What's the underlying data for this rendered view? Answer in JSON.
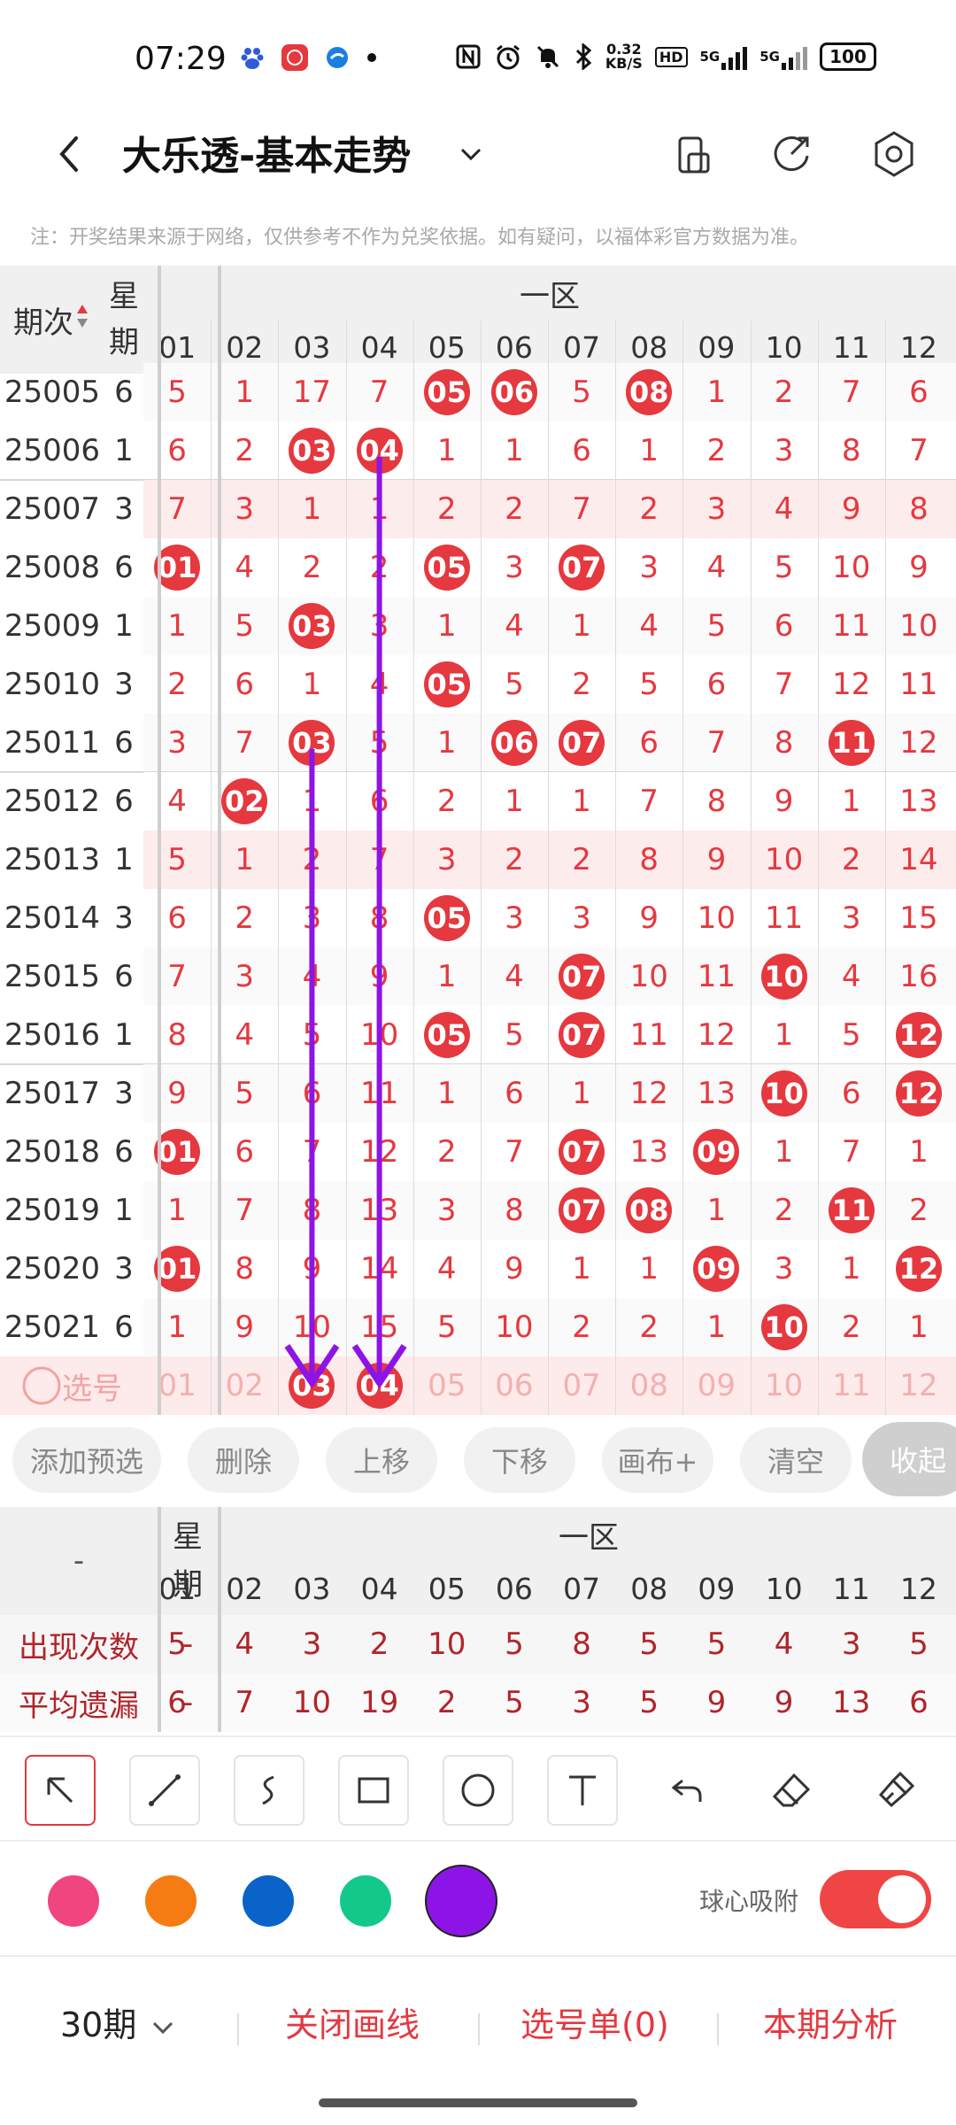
{
  "status": {
    "time": "07:29",
    "speed_top": "0.32",
    "speed_bottom": "KB/S",
    "hd": "HD",
    "net1": "5G",
    "net2": "5G",
    "battery": "100"
  },
  "header": {
    "title": "大乐透-基本走势"
  },
  "notice": "注：开奖结果来源于网络，仅供参考不作为兑奖依据。如有疑问，以福体彩官方数据为准。",
  "grid": {
    "col_period": "期次",
    "col_week_top": "星",
    "col_week_bottom": "期",
    "zone_label": "一区",
    "numbers": [
      "01",
      "02",
      "03",
      "04",
      "05",
      "06",
      "07",
      "08",
      "09",
      "10",
      "11",
      "12"
    ],
    "rows": [
      {
        "period": "25005",
        "week": "6",
        "cells": [
          "5",
          "1",
          "17",
          "7",
          "05*",
          "06*",
          "5",
          "08*",
          "1",
          "2",
          "7",
          "6"
        ]
      },
      {
        "period": "25006",
        "week": "1",
        "cells": [
          "6",
          "2",
          "03*",
          "04*",
          "1",
          "1",
          "6",
          "1",
          "2",
          "3",
          "8",
          "7"
        ]
      },
      {
        "period": "25007",
        "week": "3",
        "cells": [
          "7",
          "3",
          "1",
          "1",
          "2",
          "2",
          "7",
          "2",
          "3",
          "4",
          "9",
          "8"
        ]
      },
      {
        "period": "25008",
        "week": "6",
        "cells": [
          "01*",
          "4",
          "2",
          "2",
          "05*",
          "3",
          "07*",
          "3",
          "4",
          "5",
          "10",
          "9"
        ]
      },
      {
        "period": "25009",
        "week": "1",
        "cells": [
          "1",
          "5",
          "03*",
          "3",
          "1",
          "4",
          "1",
          "4",
          "5",
          "6",
          "11",
          "10"
        ]
      },
      {
        "period": "25010",
        "week": "3",
        "cells": [
          "2",
          "6",
          "1",
          "4",
          "05*",
          "5",
          "2",
          "5",
          "6",
          "7",
          "12",
          "11"
        ]
      },
      {
        "period": "25011",
        "week": "6",
        "cells": [
          "3",
          "7",
          "03*",
          "5",
          "1",
          "06*",
          "07*",
          "6",
          "7",
          "8",
          "11*",
          "12"
        ]
      },
      {
        "period": "25012",
        "week": "6",
        "cells": [
          "4",
          "02*",
          "1",
          "6",
          "2",
          "1",
          "1",
          "7",
          "8",
          "9",
          "1",
          "13"
        ]
      },
      {
        "period": "25013",
        "week": "1",
        "cells": [
          "5",
          "1",
          "2",
          "7",
          "3",
          "2",
          "2",
          "8",
          "9",
          "10",
          "2",
          "14"
        ]
      },
      {
        "period": "25014",
        "week": "3",
        "cells": [
          "6",
          "2",
          "3",
          "8",
          "05*",
          "3",
          "3",
          "9",
          "10",
          "11",
          "3",
          "15"
        ]
      },
      {
        "period": "25015",
        "week": "6",
        "cells": [
          "7",
          "3",
          "4",
          "9",
          "1",
          "4",
          "07*",
          "10",
          "11",
          "10*",
          "4",
          "16"
        ]
      },
      {
        "period": "25016",
        "week": "1",
        "cells": [
          "8",
          "4",
          "5",
          "10",
          "05*",
          "5",
          "07*",
          "11",
          "12",
          "1",
          "5",
          "12*"
        ]
      },
      {
        "period": "25017",
        "week": "3",
        "cells": [
          "9",
          "5",
          "6",
          "11",
          "1",
          "6",
          "1",
          "12",
          "13",
          "10*",
          "6",
          "12*"
        ]
      },
      {
        "period": "25018",
        "week": "6",
        "cells": [
          "01*",
          "6",
          "7",
          "12",
          "2",
          "7",
          "07*",
          "13",
          "09*",
          "1",
          "7",
          "1"
        ]
      },
      {
        "period": "25019",
        "week": "1",
        "cells": [
          "1",
          "7",
          "8",
          "13",
          "3",
          "8",
          "07*",
          "08*",
          "1",
          "2",
          "11*",
          "2"
        ]
      },
      {
        "period": "25020",
        "week": "3",
        "cells": [
          "01*",
          "8",
          "9",
          "14",
          "4",
          "9",
          "1",
          "1",
          "09*",
          "3",
          "1",
          "12*"
        ]
      },
      {
        "period": "25021",
        "week": "6",
        "cells": [
          "1",
          "9",
          "10",
          "15",
          "5",
          "10",
          "2",
          "2",
          "1",
          "10*",
          "2",
          "1"
        ]
      }
    ],
    "select_label": "选号",
    "select_row": [
      "01",
      "02",
      "03*",
      "04*",
      "05",
      "06",
      "07",
      "08",
      "09",
      "10",
      "11",
      "12"
    ]
  },
  "actions": {
    "add": "添加预选",
    "delete": "删除",
    "up": "上移",
    "down": "下移",
    "canvas": "画布+",
    "clear": "清空",
    "collapse": "收起"
  },
  "stats": {
    "dash": "-",
    "week_top": "星",
    "week_bottom": "期",
    "zone_label": "一区",
    "row1_label": "出现次数",
    "row1_week": "-",
    "row1": [
      "5",
      "4",
      "3",
      "2",
      "10",
      "5",
      "8",
      "5",
      "5",
      "4",
      "3",
      "5"
    ],
    "row2_label": "平均遗漏",
    "row2_week": "-",
    "row2": [
      "6",
      "7",
      "10",
      "19",
      "2",
      "5",
      "3",
      "5",
      "9",
      "9",
      "13",
      "6"
    ]
  },
  "colors": {
    "accent": "#e5383f",
    "pink": "#f0457f",
    "orange": "#f57c12",
    "blue": "#0a63c9",
    "green": "#12c989",
    "purple": "#8d14e6"
  },
  "snap_label": "球心吸附",
  "bottom": {
    "periods": "30期",
    "close_draw": "关闭画线",
    "pick_list": "选号单(0)",
    "analysis": "本期分析"
  }
}
